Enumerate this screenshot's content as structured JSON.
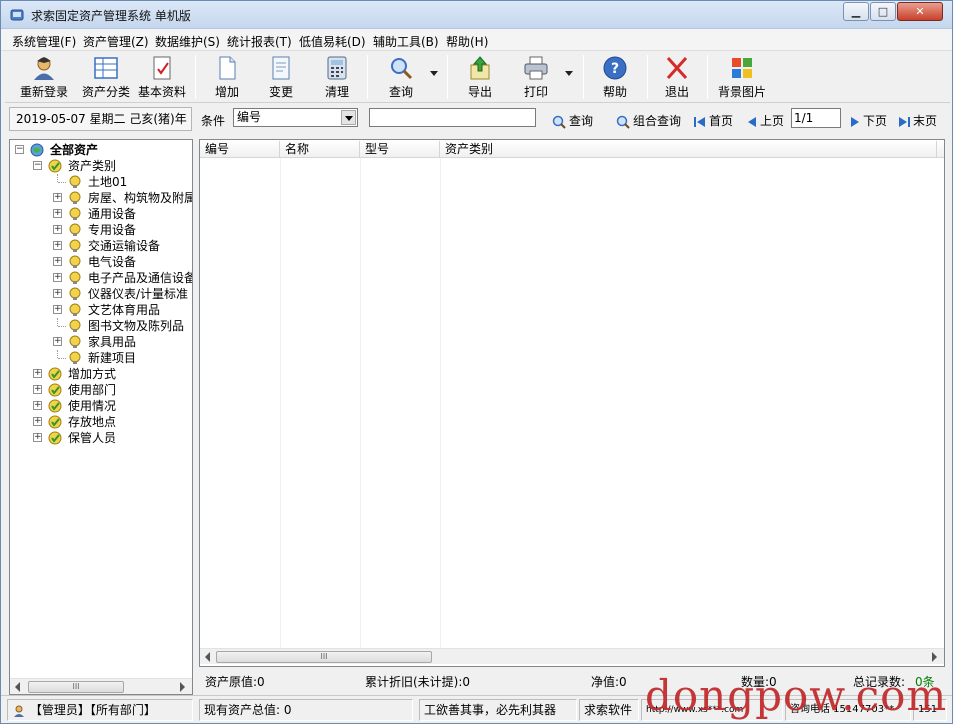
{
  "window": {
    "title": "求索固定资产管理系统 单机版",
    "min": "0",
    "max": "1",
    "close": "x"
  },
  "menu": [
    "系统管理(F)",
    "资产管理(Z)",
    "数据维护(S)",
    "统计报表(T)",
    "低值易耗(D)",
    "辅助工具(B)",
    "帮助(H)"
  ],
  "toolbar": {
    "relogin": "重新登录",
    "category": "资产分类",
    "basic": "基本资料",
    "add": "增加",
    "change": "变更",
    "clear": "清理",
    "query": "查询",
    "export": "导出",
    "print": "打印",
    "help": "帮助",
    "exit": "退出",
    "bgimage": "背景图片"
  },
  "querybar": {
    "date": "2019-05-07 星期二 己亥(猪)年",
    "condition_label": "条件",
    "condition_value": "编号",
    "search_value": "",
    "query_btn": "查询",
    "combo_query_btn": "组合查询",
    "first": "首页",
    "prev": "上页",
    "page": "1/1",
    "next": "下页",
    "last": "末页"
  },
  "tree": {
    "root": "全部资产",
    "category": "资产类别",
    "items": [
      "土地01",
      "房屋、构筑物及附属",
      "通用设备",
      "专用设备",
      "交通运输设备",
      "电气设备",
      "电子产品及通信设备",
      "仪器仪表/计量标准",
      "文艺体育用品",
      "图书文物及陈列品",
      "家具用品",
      "新建项目"
    ],
    "groups": [
      "增加方式",
      "使用部门",
      "使用情况",
      "存放地点",
      "保管人员"
    ]
  },
  "grid": {
    "columns": [
      "编号",
      "名称",
      "型号",
      "资产类别"
    ]
  },
  "summary": {
    "original": "资产原值:0",
    "depreciation": "累计折旧(未计提):0",
    "net": "净值:0",
    "quantity": "数量:0",
    "total_label": "总记录数:",
    "total_value": "0条"
  },
  "status": {
    "user": "【管理员】【所有部门】",
    "current_total": "现有资产总值: 0",
    "motto": "工欲善其事，必先利其器",
    "brand": "求索软件",
    "url": "http://www.xs***.com",
    "contact": "咨询电话 15147703**",
    "extra": "151"
  },
  "watermark": "dongpow.com",
  "colors": {
    "accent": "#3a6fc4",
    "watermark": "#c0282a",
    "summary_total": "#008000"
  }
}
